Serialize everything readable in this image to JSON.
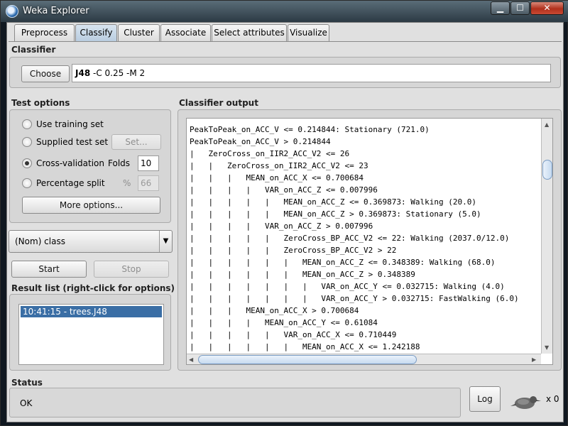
{
  "window": {
    "title": "Weka Explorer"
  },
  "tabs": [
    {
      "label": "Preprocess"
    },
    {
      "label": "Classify",
      "active": true
    },
    {
      "label": "Cluster"
    },
    {
      "label": "Associate"
    },
    {
      "label": "Select attributes"
    },
    {
      "label": "Visualize"
    }
  ],
  "classifier": {
    "section_label": "Classifier",
    "choose_label": "Choose",
    "name": "J48",
    "options": " -C 0.25 -M 2"
  },
  "test_options": {
    "section_label": "Test options",
    "use_training_set": "Use training set",
    "supplied_test_set": "Supplied test set",
    "set_button": "Set...",
    "cross_validation": "Cross-validation",
    "folds_label": "Folds",
    "folds_value": "10",
    "percentage_split": "Percentage split",
    "percent_symbol": "%",
    "percentage_value": "66",
    "more_options": "More options...",
    "selected": "cross_validation"
  },
  "class_selector": {
    "value": "(Nom) class"
  },
  "run": {
    "start_label": "Start",
    "stop_label": "Stop"
  },
  "result_list": {
    "section_label": "Result list (right-click for options)",
    "items": [
      "10:41:15 - trees.J48"
    ]
  },
  "output": {
    "section_label": "Classifier output",
    "lines": [
      "PeakToPeak_on_ACC_V <= 0.214844: Stationary (721.0)",
      "PeakToPeak_on_ACC_V > 0.214844",
      "|   ZeroCross_on_IIR2_ACC_V2 <= 26",
      "|   |   ZeroCross_on_IIR2_ACC_V2 <= 23",
      "|   |   |   MEAN_on_ACC_X <= 0.700684",
      "|   |   |   |   VAR_on_ACC_Z <= 0.007996",
      "|   |   |   |   |   MEAN_on_ACC_Z <= 0.369873: Walking (20.0)",
      "|   |   |   |   |   MEAN_on_ACC_Z > 0.369873: Stationary (5.0)",
      "|   |   |   |   VAR_on_ACC_Z > 0.007996",
      "|   |   |   |   |   ZeroCross_BP_ACC_V2 <= 22: Walking (2037.0/12.0)",
      "|   |   |   |   |   ZeroCross_BP_ACC_V2 > 22",
      "|   |   |   |   |   |   MEAN_on_ACC_Z <= 0.348389: Walking (68.0)",
      "|   |   |   |   |   |   MEAN_on_ACC_Z > 0.348389",
      "|   |   |   |   |   |   |   VAR_on_ACC_Y <= 0.032715: Walking (4.0)",
      "|   |   |   |   |   |   |   VAR_on_ACC_Y > 0.032715: FastWalking (6.0)",
      "|   |   |   MEAN_on_ACC_X > 0.700684",
      "|   |   |   |   MEAN_on_ACC_Y <= 0.61084",
      "|   |   |   |   |   VAR_on_ACC_X <= 0.710449",
      "|   |   |   |   |   |   MEAN_on_ACC_X <= 1.242188"
    ]
  },
  "status": {
    "section_label": "Status",
    "text": "OK",
    "log_label": "Log",
    "task_count": "x 0"
  },
  "icons": {
    "app": "weka-logo-icon",
    "bird": "weka-bird-icon"
  }
}
